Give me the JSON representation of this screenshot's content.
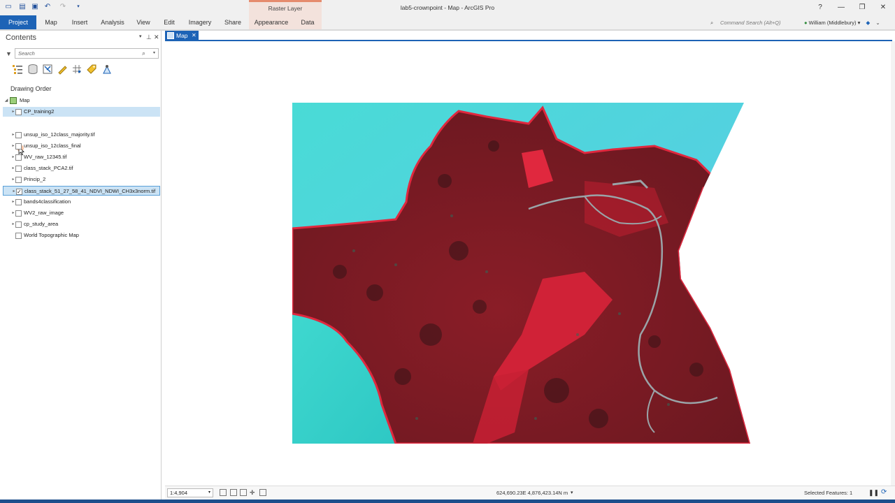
{
  "window": {
    "title": "lab5-crownpoint - Map - ArcGIS Pro",
    "help": "?",
    "minimize": "—",
    "restore": "❐",
    "close": "✕"
  },
  "context_tab": {
    "header": "Raster Layer"
  },
  "ribbon": {
    "tabs": [
      "Project",
      "Map",
      "Insert",
      "Analysis",
      "View",
      "Edit",
      "Imagery",
      "Share",
      "Appearance",
      "Data"
    ],
    "command_search_placeholder": "Command Search (Alt+Q)",
    "user": "William (Middlebury)"
  },
  "contents": {
    "title": "Contents",
    "search_placeholder": "Search",
    "section": "Drawing Order",
    "map_label": "Map",
    "layers": [
      {
        "name": "CP_training2",
        "checked": false,
        "expandable": true
      },
      {
        "name": "unsup_iso_12class_majority.tif",
        "checked": false,
        "expandable": true
      },
      {
        "name": "unsup_iso_12class_final",
        "checked": false,
        "expandable": true
      },
      {
        "name": "WV_raw_12345.tif",
        "checked": false,
        "expandable": true
      },
      {
        "name": "class_stack_PCA2.tif",
        "checked": false,
        "expandable": true
      },
      {
        "name": "Princip_2",
        "checked": false,
        "expandable": true
      },
      {
        "name": "class_stack_51_27_58_41_NDVI_NDWI_CH3x3norm.tif",
        "checked": true,
        "expandable": true
      },
      {
        "name": "bands4classification",
        "checked": false,
        "expandable": true
      },
      {
        "name": "WV2_raw_image",
        "checked": false,
        "expandable": true
      },
      {
        "name": "cp_study_area",
        "checked": false,
        "expandable": true
      },
      {
        "name": "World Topographic Map",
        "checked": false,
        "expandable": false
      }
    ]
  },
  "map_view": {
    "tab_label": "Map",
    "imagery_colors": {
      "water": "#3fd6d3",
      "vegetation": "#7a1a22",
      "bright_red": "#e0283e",
      "roads": "#9aa4a8"
    }
  },
  "status": {
    "scale": "1:4,904",
    "coordinates": "624,690.23E 4,876,423.14N m",
    "selected_features": "Selected Features: 1"
  },
  "colors": {
    "accent": "#1d63b6",
    "context_tab": "#f3e2dc",
    "selection": "#cbe3f5"
  }
}
